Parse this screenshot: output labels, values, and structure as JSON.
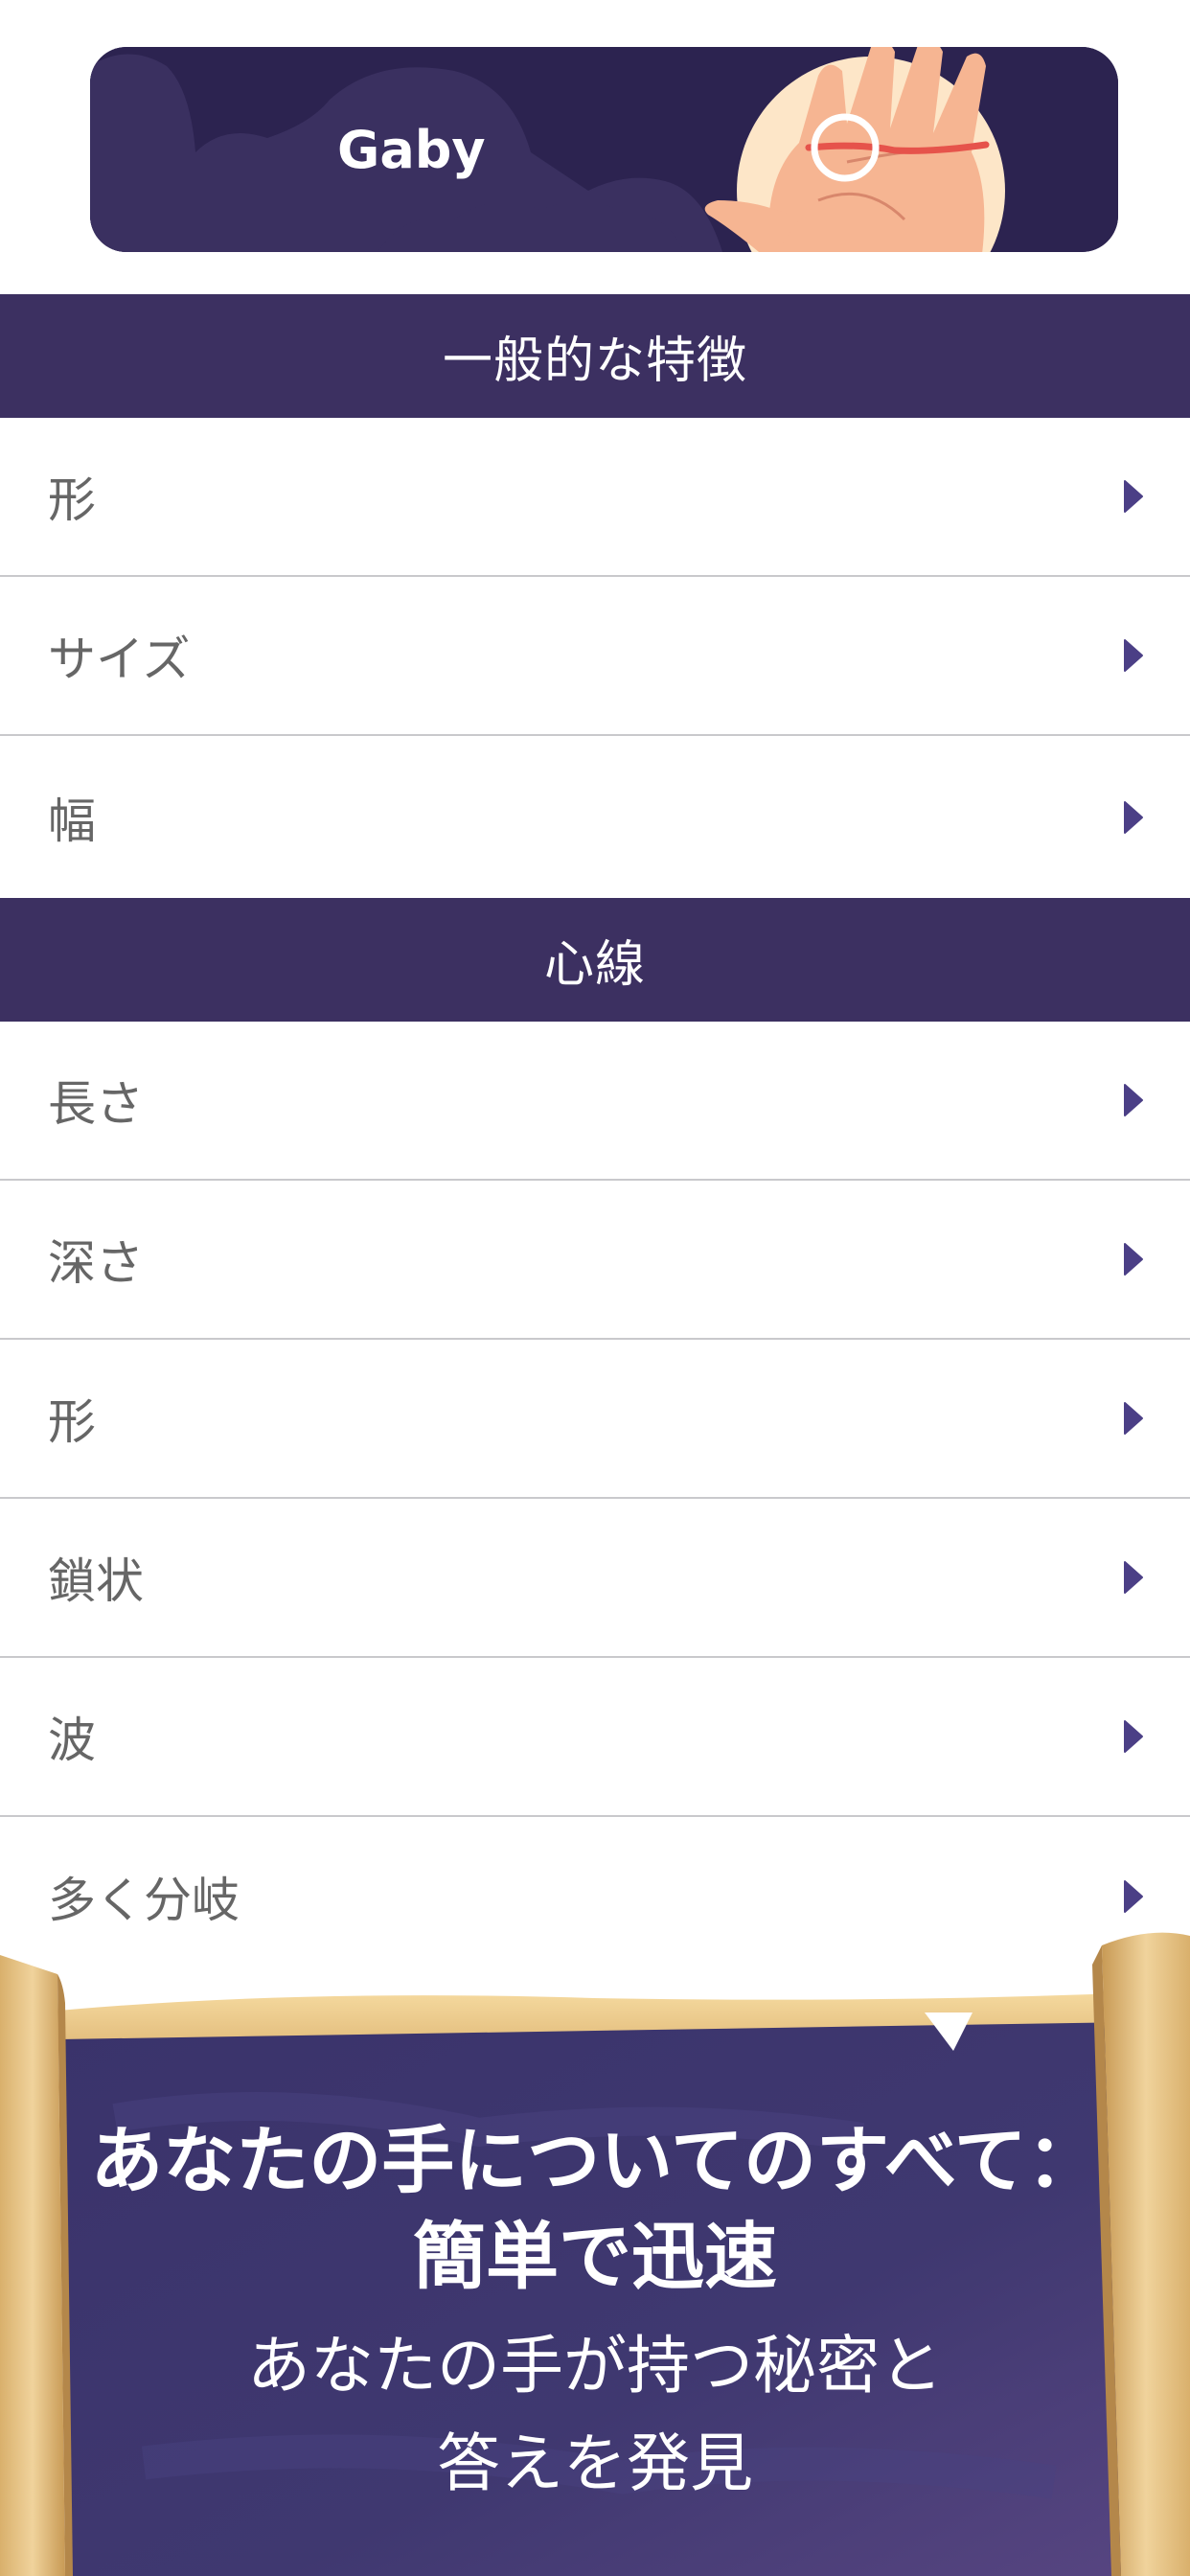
{
  "banner": {
    "name": "Gaby"
  },
  "sections": [
    {
      "title": "一般的な特徴",
      "items": [
        "形",
        "サイズ",
        "幅"
      ]
    },
    {
      "title": "心線",
      "items": [
        "長さ",
        "深さ",
        "形",
        "鎖状",
        "波",
        "多く分岐"
      ]
    }
  ],
  "promo": {
    "title_line1": "あなたの手についてのすべて：",
    "title_line2": "簡単で迅速",
    "subtitle_line1": "あなたの手が持つ秘密と",
    "subtitle_line2": "答えを発見"
  },
  "icons": {
    "row_chevron": "chevron-right-icon",
    "banner_art": "palm-icon"
  },
  "colors": {
    "section_header_bg": "#3c3061",
    "banner_bg": "#2c2350",
    "chevron": "#4b3f86",
    "row_text": "#666666",
    "promo_bg": "#3f3870",
    "scroll_paper": "#e8c98d"
  }
}
